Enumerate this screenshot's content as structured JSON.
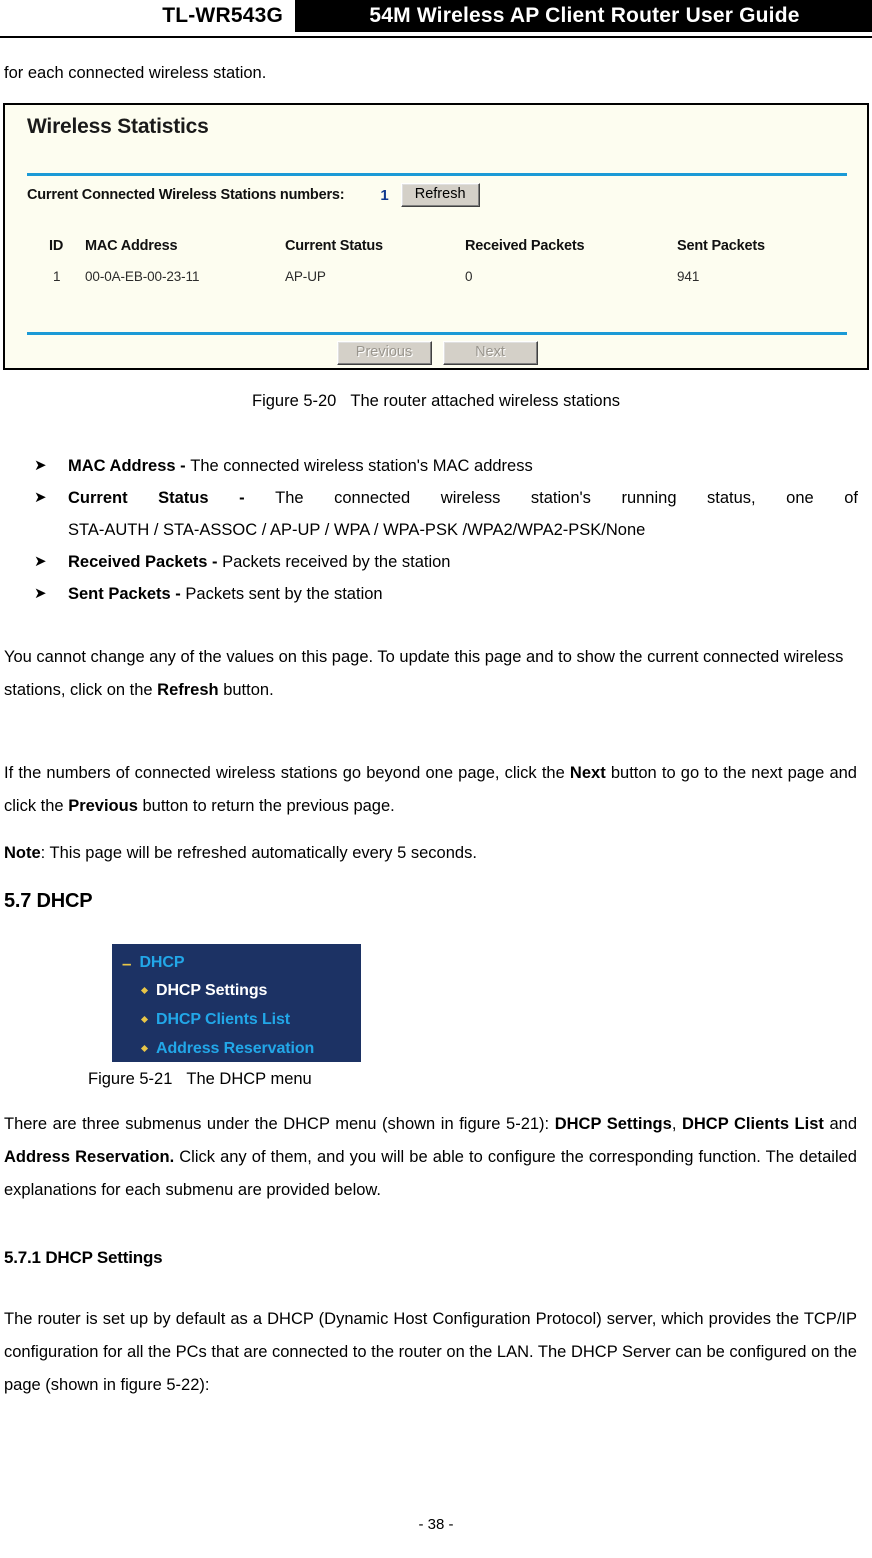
{
  "header": {
    "model": "TL-WR543G",
    "title": "54M  Wireless  AP  Client  Router  User  Guide"
  },
  "intro_text": "for each connected wireless station.",
  "wireless_statistics": {
    "panel_title": "Wireless Statistics",
    "connected_label": "Current Connected Wireless Stations numbers:",
    "connected_count": "1",
    "refresh_button": "Refresh",
    "columns": [
      "ID",
      "MAC Address",
      "Current Status",
      "Received Packets",
      "Sent Packets"
    ],
    "rows": [
      {
        "id": "1",
        "mac": "00-0A-EB-00-23-11",
        "status": "AP-UP",
        "received": "0",
        "sent": "941"
      }
    ],
    "previous_button": "Previous",
    "next_button": "Next",
    "accent_color": "#1b9ad6",
    "panel_background": "#fdfdf0",
    "count_color": "#123a8f"
  },
  "figure_5_20_caption": {
    "label": "Figure 5-20",
    "text": "The router attached wireless stations"
  },
  "definitions": [
    {
      "term": "MAC Address - ",
      "desc": "The connected wireless station's MAC address",
      "justified": false
    },
    {
      "term": "Current Status - ",
      "desc": "The connected wireless station's running status, one of",
      "justified": true
    },
    {
      "term": "",
      "desc": "STA-AUTH / STA-ASSOC / AP-UP / WPA / WPA-PSK /WPA2/WPA2-PSK/None",
      "justified": false,
      "continuation": true
    },
    {
      "term": "Received Packets - ",
      "desc": "Packets received by the station",
      "justified": false
    },
    {
      "term": "Sent Packets - ",
      "desc": "Packets sent by the station",
      "justified": false
    }
  ],
  "paragraphs": {
    "refresh": {
      "part1": "You cannot change any of the values on this page. To update this page and to show the current connected wireless stations, click on the ",
      "bold1": "Refresh",
      "part2": " button."
    },
    "nextprev": {
      "part1": "If the numbers of connected wireless stations go beyond one page, click the ",
      "bold1": "Next",
      "part2": " button to go to the next page and click the ",
      "bold2": "Previous",
      "part3": " button to return the previous page."
    },
    "note": {
      "bold1": "Note",
      "part1": ": This page will be refreshed automatically every 5 seconds."
    },
    "submenus": {
      "part1": "There are three submenus under the DHCP menu (shown in figure 5-21): ",
      "bold1": "DHCP Settings",
      "part2": ", ",
      "bold2": "DHCP Clients List",
      "part3": " and ",
      "bold3": "Address Reservation.",
      "part4": " Click any of them, and you will be able to configure the corresponding function. The detailed explanations for each submenu are provided below."
    },
    "dhcp_desc": {
      "part1": "The router is set up by default as a DHCP (Dynamic Host Configuration Protocol) server, which provides the TCP/IP configuration for all the PCs that are connected to the router on the LAN. The DHCP Server can be configured on the page (shown in figure 5-22):"
    }
  },
  "headings": {
    "section_5_7": "5.7 DHCP",
    "section_5_7_1": "5.7.1 DHCP Settings"
  },
  "dhcp_menu": {
    "root_label": "DHCP",
    "collapse_glyph": "–",
    "items": [
      {
        "label": "DHCP Settings",
        "selected": true
      },
      {
        "label": "DHCP Clients List",
        "selected": false
      },
      {
        "label": "Address Reservation",
        "selected": false
      }
    ],
    "background_color": "#1c3264",
    "link_color": "#22a7e8",
    "bullet_color": "#e8c547"
  },
  "figure_5_21_caption": {
    "label": "Figure 5-21",
    "text": "The DHCP menu"
  },
  "footer": {
    "page_number": "- 38 -"
  }
}
